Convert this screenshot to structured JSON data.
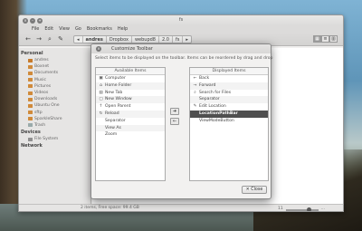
{
  "window": {
    "title": "fs",
    "menu": [
      "File",
      "Edit",
      "View",
      "Go",
      "Bookmarks",
      "Help"
    ],
    "breadcrumbs": [
      "andres",
      "Dropbox",
      "webupd8",
      "2.0",
      "fs"
    ]
  },
  "sidebar": {
    "personal_heading": "Personal",
    "personal": [
      "andres",
      "Boxnet",
      "Documents",
      "Music",
      "Pictures",
      "Videos",
      "Downloads",
      "Ubuntu One",
      "sftp",
      "SparkleShare",
      "Trash"
    ],
    "devices_heading": "Devices",
    "devices": [
      "File System"
    ],
    "network_heading": "Network"
  },
  "status": {
    "text": "2 items, Free space: 99.4 GB",
    "zoom_left": "11",
    "zoom_right": "...",
    "zoom_level": 0.75
  },
  "dialog": {
    "title": "Customize Toolbar",
    "close_x": "×",
    "instructions": "Select items to be displayed on the toolbar. Items can be reordered by drag and drop",
    "available_heading": "Available Items",
    "available": [
      {
        "label": "Computer",
        "icon": "computer-icon",
        "glyph": "▣"
      },
      {
        "label": "Home Folder",
        "icon": "home-icon",
        "glyph": "⌂"
      },
      {
        "label": "New Tab",
        "icon": "new-tab-icon",
        "glyph": "▤"
      },
      {
        "label": "New Window",
        "icon": "new-window-icon",
        "glyph": "▢"
      },
      {
        "label": "Open Parent",
        "icon": "up-arrow-icon",
        "glyph": "↑"
      },
      {
        "label": "Reload",
        "icon": "reload-icon",
        "glyph": "↻"
      },
      {
        "label": "Separator",
        "icon": "",
        "glyph": ""
      },
      {
        "label": "View As",
        "icon": "",
        "glyph": ""
      },
      {
        "label": "Zoom",
        "icon": "",
        "glyph": ""
      }
    ],
    "displayed_heading": "Displayed Items",
    "displayed": [
      {
        "label": "Back",
        "icon": "back-arrow-icon",
        "glyph": "←"
      },
      {
        "label": "Forward",
        "icon": "forward-arrow-icon",
        "glyph": "→"
      },
      {
        "label": "Search for Files",
        "icon": "search-icon",
        "glyph": "⌕"
      },
      {
        "label": "Separator",
        "icon": "",
        "glyph": ""
      },
      {
        "label": "Edit Location",
        "icon": "edit-location-icon",
        "glyph": "✎"
      },
      {
        "label": "LocationPathBar",
        "icon": "",
        "glyph": ""
      },
      {
        "label": "ViewModeButton",
        "icon": "",
        "glyph": ""
      }
    ],
    "selected_displayed_index": 5,
    "add_glyph": "➜",
    "remove_glyph": "←",
    "close_button": "Close",
    "close_glyph": "✕"
  },
  "colors": {
    "selection": "#4f4f4f",
    "folder": "#d08a3a"
  }
}
